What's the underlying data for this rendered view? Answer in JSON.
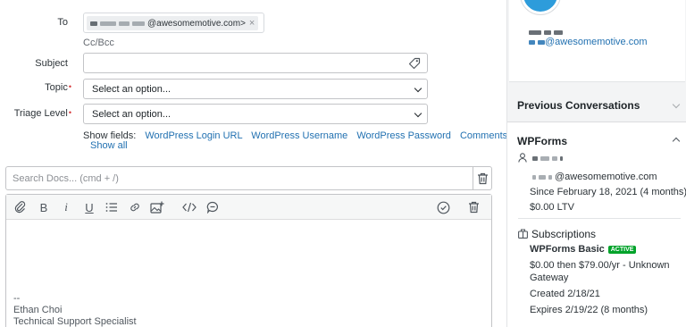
{
  "compose": {
    "to_label": "To",
    "to_chip_domain": "@awesomemotive.com>",
    "to_chip_remove": "×",
    "ccbcc": "Cc/Bcc",
    "subject_label": "Subject",
    "topic_label": "Topic",
    "topic_value": "Select an option...",
    "triage_label": "Triage Level",
    "triage_value": "Select an option...",
    "required_mark": "•",
    "show_fields_label": "Show fields:",
    "show_fields": [
      "WordPress Login URL",
      "WordPress Username",
      "WordPress Password",
      "Comments ..."
    ],
    "show_all": "Show all"
  },
  "docs": {
    "search_placeholder": "Search Docs... (cmd + /)"
  },
  "editor": {
    "toolbar_icons": [
      "attach-icon",
      "bold-icon",
      "italic-icon",
      "underline-icon",
      "list-icon",
      "link-icon",
      "image-add-icon",
      "code-icon",
      "saved-reply-icon",
      "check-circle-icon",
      "trash-icon"
    ],
    "signature": [
      "--",
      "Ethan Choi",
      "Technical Support Specialist"
    ]
  },
  "sidebar": {
    "customer_email": "@awesomemotive.com",
    "previous_conversations": "Previous Conversations",
    "wpforms": {
      "title": "WPForms",
      "email": "@awesomemotive.com",
      "since": "Since February 18, 2021 (4 months)",
      "ltv": "$0.00 LTV",
      "subscriptions_title": "Subscriptions",
      "plan": "WPForms Basic",
      "plan_status": "ACTIVE",
      "price_line1": "$0.00 then $79.00/yr - Unknown",
      "price_line2": "Gateway",
      "created": "Created 2/18/21",
      "expires": "Expires 2/19/22 (8 months)"
    }
  },
  "colors": {
    "link": "#2271b1",
    "required": "#d63638",
    "active_badge": "#00a32a",
    "avatar": "#2d9cdb"
  }
}
